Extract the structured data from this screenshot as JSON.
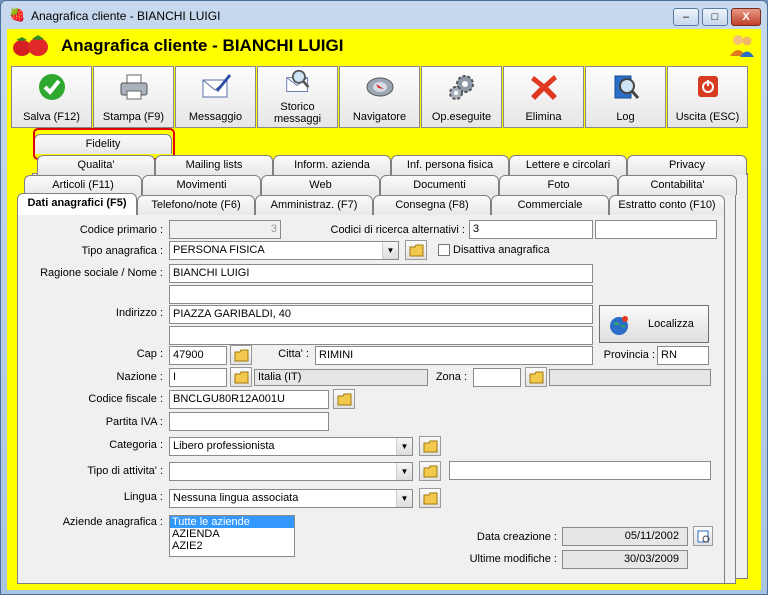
{
  "window": {
    "title": "Anagrafica cliente - BIANCHI LUIGI",
    "min_label": "–",
    "max_label": "□",
    "close_label": "X"
  },
  "header": {
    "title": "Anagrafica cliente - BIANCHI LUIGI"
  },
  "toolbar": [
    {
      "label": "Salva (F12)",
      "icon": "check-icon"
    },
    {
      "label": "Stampa (F9)",
      "icon": "printer-icon"
    },
    {
      "label": "Messaggio",
      "icon": "message-icon"
    },
    {
      "label": "Storico messaggi",
      "icon": "message-history-icon"
    },
    {
      "label": "Navigatore",
      "icon": "navigator-icon"
    },
    {
      "label": "Op.eseguite",
      "icon": "gears-icon"
    },
    {
      "label": "Elimina",
      "icon": "delete-icon"
    },
    {
      "label": "Log",
      "icon": "log-icon"
    },
    {
      "label": "Uscita (ESC)",
      "icon": "exit-icon"
    }
  ],
  "tabs": {
    "row0": [
      "Fidelity"
    ],
    "row1": [
      "Qualita'",
      "Mailing lists",
      "Inform. azienda",
      "Inf. persona fisica",
      "Lettere e circolari",
      "Privacy"
    ],
    "row2": [
      "Articoli (F11)",
      "Movimenti",
      "Web",
      "Documenti",
      "Foto",
      "Contabilita'"
    ],
    "row3": [
      "Dati anagrafici (F5)",
      "Telefono/note (F6)",
      "Amministraz. (F7)",
      "Consegna (F8)",
      "Commerciale",
      "Estratto conto (F10)"
    ]
  },
  "form": {
    "codice_primario": {
      "label": "Codice primario :",
      "value": "3"
    },
    "codici_alternativi": {
      "label": "Codici di ricerca alternativi :",
      "value": "3",
      "value2": ""
    },
    "tipo_anagrafica": {
      "label": "Tipo anagrafica :",
      "value": "PERSONA FISICA"
    },
    "disattiva": {
      "label": "Disattiva anagrafica"
    },
    "ragione_sociale": {
      "label": "Ragione sociale / Nome :",
      "value": "BIANCHI LUIGI",
      "value2": ""
    },
    "indirizzo": {
      "label": "Indirizzo :",
      "value": "PIAZZA GARIBALDI, 40",
      "value2": ""
    },
    "localizza": {
      "label": "Localizza"
    },
    "cap": {
      "label": "Cap :",
      "value": "47900"
    },
    "citta": {
      "label": "Citta' :",
      "value": "RIMINI"
    },
    "provincia": {
      "label": "Provincia :",
      "value": "RN"
    },
    "nazione": {
      "label": "Nazione :",
      "value": "I",
      "desc": "Italia (IT)"
    },
    "zona": {
      "label": "Zona :",
      "value": "",
      "desc": ""
    },
    "codice_fiscale": {
      "label": "Codice fiscale :",
      "value": "BNCLGU80R12A001U"
    },
    "partita_iva": {
      "label": "Partita IVA :",
      "value": ""
    },
    "categoria": {
      "label": "Categoria :",
      "value": "Libero professionista"
    },
    "tipo_attivita": {
      "label": "Tipo di attivita' :",
      "value": "",
      "desc": ""
    },
    "lingua": {
      "label": "Lingua :",
      "value": "Nessuna lingua associata"
    },
    "aziende": {
      "label": "Aziende anagrafica :",
      "items": [
        "Tutte le aziende",
        "AZIENDA",
        "AZIE2"
      ]
    },
    "data_creazione": {
      "label": "Data creazione :",
      "value": "05/11/2002"
    },
    "ultime_modifiche": {
      "label": "Ultime modifiche :",
      "value": "30/03/2009"
    }
  },
  "colors": {
    "background": "#ffff00",
    "highlight": "#e00000",
    "selected": "#3399ff"
  }
}
